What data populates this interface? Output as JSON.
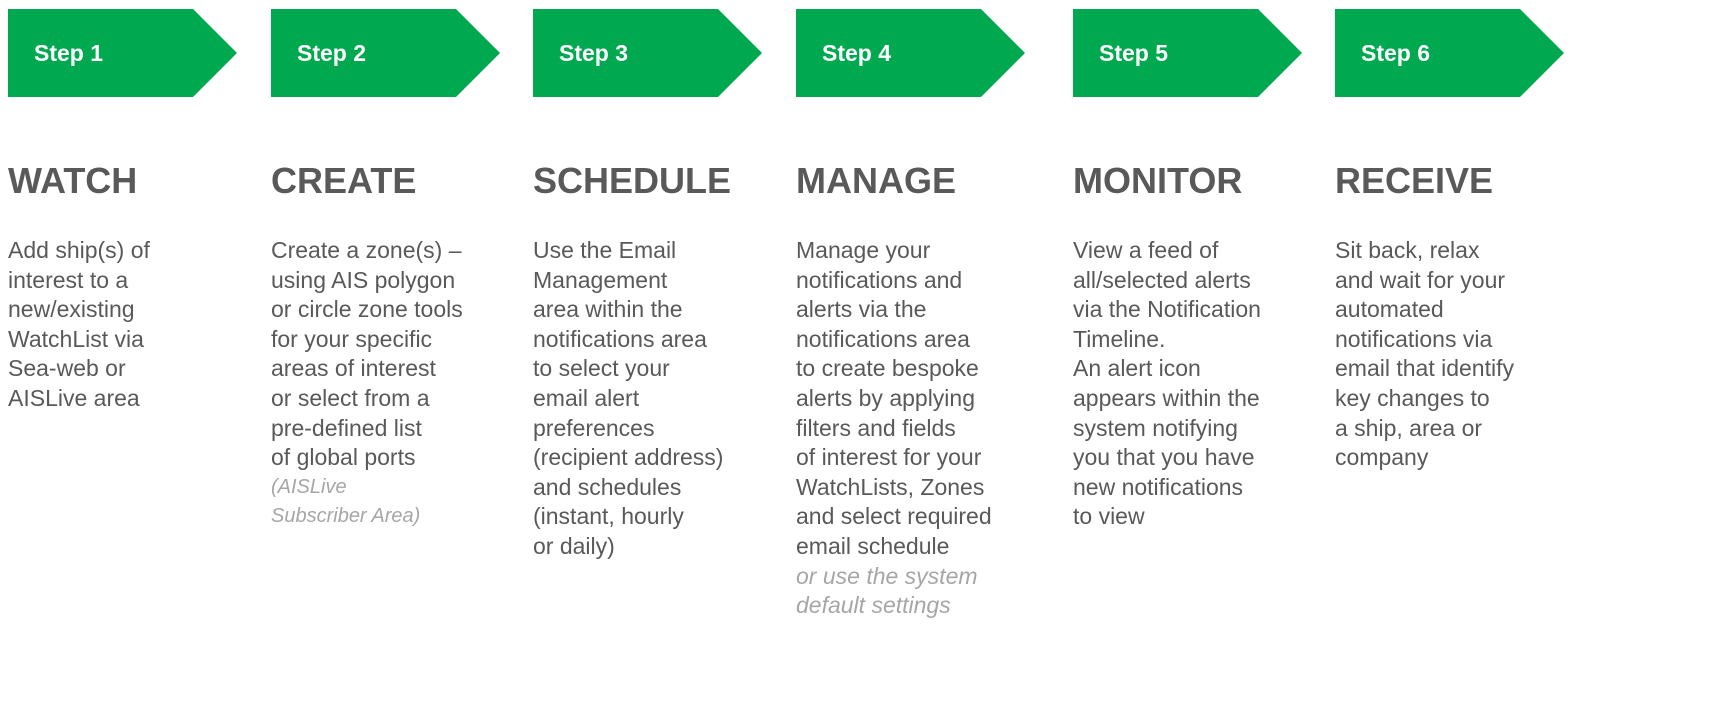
{
  "colors": {
    "arrow": "#00a94f",
    "arrow_text": "#ffffff",
    "title": "#595959",
    "body": "#595959",
    "note": "#a6a6a6"
  },
  "steps": [
    {
      "label": "Step 1",
      "title": "WATCH",
      "lines": [
        "Add ship(s) of",
        "interest to a",
        "new/existing",
        "WatchList via",
        "Sea-web or",
        "AISLive area"
      ],
      "note_lines": []
    },
    {
      "label": "Step 2",
      "title": "CREATE",
      "lines": [
        "Create a zone(s) –",
        "using AIS polygon",
        "or circle zone tools",
        "for your specific",
        "areas of interest",
        "or select from a",
        "pre-defined list",
        "of global ports"
      ],
      "note_lines": [
        "(AISLive",
        "Subscriber Area)"
      ]
    },
    {
      "label": "Step 3",
      "title": "SCHEDULE",
      "lines": [
        "Use the Email",
        "Management",
        "area within the",
        "notifications area",
        "to select your",
        "email alert",
        "preferences",
        "(recipient address)",
        "and schedules",
        "(instant, hourly",
        "or daily)"
      ],
      "note_lines": []
    },
    {
      "label": "Step 4",
      "title": "MANAGE",
      "lines": [
        "Manage your",
        "notifications and",
        "alerts via the",
        "notifications area",
        "to create bespoke",
        "alerts by applying",
        "filters and fields",
        "of interest for your",
        "WatchLists, Zones",
        "and select required",
        "email schedule"
      ],
      "note_lines": [
        "or use the system",
        "default settings"
      ]
    },
    {
      "label": "Step 5",
      "title": "MONITOR",
      "lines": [
        "View a feed of",
        "all/selected alerts",
        "via the Notification",
        "Timeline.",
        "An alert icon",
        "appears within the",
        "system notifying",
        "you that you have",
        "new notifications",
        "to view"
      ],
      "note_lines": []
    },
    {
      "label": "Step 6",
      "title": "RECEIVE",
      "lines": [
        "Sit back, relax",
        "and wait for your",
        "automated",
        "notifications via",
        "email that identify",
        "key changes to",
        "a ship, area or",
        "company"
      ],
      "note_lines": []
    }
  ]
}
